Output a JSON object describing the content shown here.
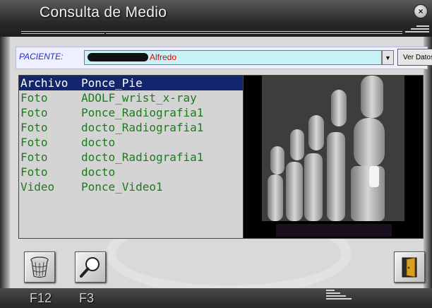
{
  "window": {
    "title": "Consulta de Medio",
    "close_label": "×"
  },
  "patient": {
    "label": "PACIENTE:",
    "value": "Alfredo",
    "dropdown_arrow": "▼",
    "view_button": "Ver Datos"
  },
  "media_list": {
    "header": {
      "type": "Archivo",
      "name": "Ponce_Pie"
    },
    "items": [
      {
        "type": "Foto",
        "name": "ADOLF_wrist_x-ray"
      },
      {
        "type": "Foto",
        "name": "Ponce_Radiografia1"
      },
      {
        "type": "Foto",
        "name": "docto_Radiografia1"
      },
      {
        "type": "Foto",
        "name": "docto"
      },
      {
        "type": "Foto",
        "name": "docto_Radiografia1"
      },
      {
        "type": "Foto",
        "name": "docto"
      },
      {
        "type": "Video",
        "name": "Ponce_Video1"
      }
    ]
  },
  "toolbar": {
    "delete_icon": "trash-icon",
    "search_icon": "magnifier-icon",
    "exit_icon": "exit-door-icon"
  },
  "shortcuts": {
    "delete_key": "F12",
    "search_key": "F3"
  },
  "colors": {
    "title_bar": "#2a2a2a",
    "selection": "#13256e",
    "list_text": "#1e7a1e",
    "patient_label": "#1b2bd6",
    "patient_value": "#e00000",
    "combo_bg": "#c8f2f6"
  }
}
